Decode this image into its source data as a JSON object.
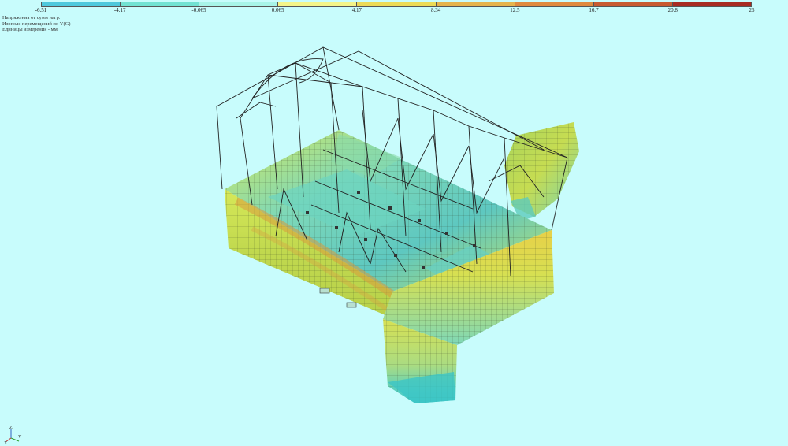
{
  "colors": {
    "background": "#c8fcfc",
    "frame_lines": "#222222",
    "mesh_grid": "#2a3a20"
  },
  "scale": {
    "ticks": [
      "-6.51",
      "-4.17",
      "-0.065",
      "0.065",
      "4.17",
      "8.34",
      "12.5",
      "16.7",
      "20.8",
      "25"
    ],
    "segment_colors": [
      "#4ec8dc",
      "#72e2d2",
      "#a8f4e8",
      "#f4f488",
      "#ecda56",
      "#e6b44c",
      "#e08a3e",
      "#c85a30",
      "#a82c22"
    ]
  },
  "info": {
    "line1": "Напряжения от сумм нагр.",
    "line2": "Изополя перемещений по Y(G)",
    "line3": "Единицы измерения - мм"
  },
  "axes": {
    "z_label": "Z",
    "x_label": "X",
    "y_label": "Y"
  }
}
